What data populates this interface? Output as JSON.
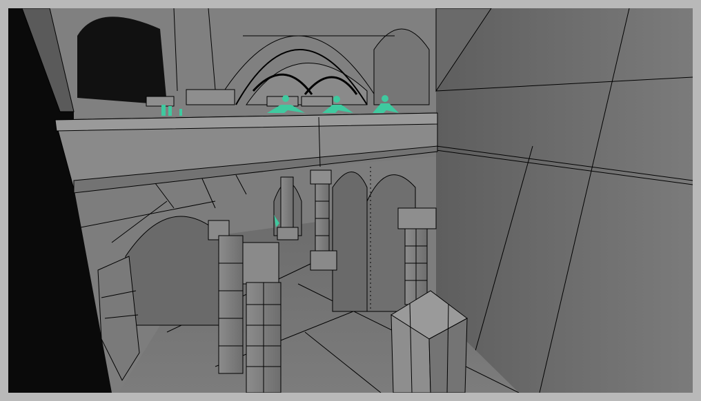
{
  "viewport": {
    "label": "",
    "background": "#7a7a7a",
    "frame_color": "#9a9a9a",
    "wire_color": "#000000",
    "shade_color": "#6f6f6f"
  },
  "scene": {
    "description_visible_text": "",
    "marker_color": "#3fc99f"
  }
}
